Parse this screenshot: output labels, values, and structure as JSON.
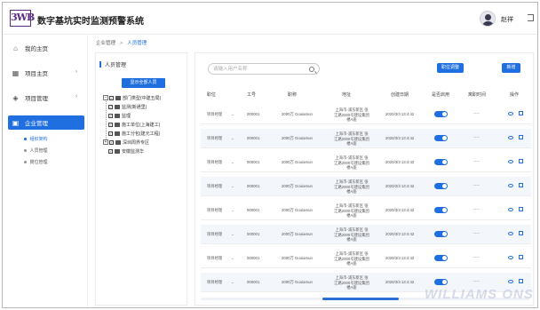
{
  "header": {
    "logo_text": "3WB",
    "title": "数字基坑实时监测预警系统",
    "username": "赵祥"
  },
  "sidebar": {
    "items": [
      {
        "label": "我的主页",
        "icon": "home-icon"
      },
      {
        "label": "项目主页",
        "icon": "grid-icon"
      },
      {
        "label": "项目管理",
        "icon": "cube-icon"
      },
      {
        "label": "企业管理",
        "icon": "building-icon"
      }
    ],
    "sub_items": [
      "组织架构",
      "人员管理",
      "岗位管理"
    ]
  },
  "breadcrumb": {
    "parent": "企业管理",
    "current": "人员管理"
  },
  "left_panel": {
    "title": "人员管理",
    "show_all_button": "显示全部人员",
    "tree": [
      {
        "label": "部门类型(中建五局)",
        "level": 0
      },
      {
        "label": "监测(新通里)",
        "level": 0
      },
      {
        "label": "监理",
        "level": 0
      },
      {
        "label": "施工单位(上海建工)",
        "level": 0
      },
      {
        "label": "施工分包(建元工程)",
        "level": 0
      },
      {
        "label": "深圳周界专区",
        "level": 0
      },
      {
        "label": "安徽监测华",
        "level": 0
      }
    ]
  },
  "right_panel": {
    "search_placeholder": "请输入用户名称",
    "btn_assign": "职位调整",
    "btn_add": "新增",
    "columns": [
      "职位",
      "工号",
      "职称",
      "地址",
      "创建日期",
      "是否启用",
      "离职时间",
      "操作"
    ],
    "rows": [
      {
        "position": "项目经理",
        "id": "000001",
        "title": "2000万 Gooiamun",
        "address": "上海市-浦东新区 张江路2000号建设集团 楼A座",
        "date": "2020/3/3 13:4:42",
        "leave": "----"
      },
      {
        "position": "项目经理",
        "id": "000001",
        "title": "2000万 Gooiamun",
        "address": "上海市-浦东新区 张江路2000号建设集团 楼A座",
        "date": "2020/3/3 13:4:42",
        "leave": "----"
      },
      {
        "position": "项目经理",
        "id": "000001",
        "title": "2000万 Gooiamun",
        "address": "上海市-浦东新区 张江路2000号建设集团 楼A座",
        "date": "2020/3/3 13:4:42",
        "leave": "----"
      },
      {
        "position": "项目经理",
        "id": "000001",
        "title": "2000万 Gooiamun",
        "address": "上海市-浦东新区 张江路2000号建设集团 楼A座",
        "date": "2020/3/3 13:4:42",
        "leave": "----"
      },
      {
        "position": "项目经理",
        "id": "000001",
        "title": "2000万 Gooiamun",
        "address": "上海市-浦东新区 张江路2000号建设集团 楼A座",
        "date": "2020/3/3 13:4:42",
        "leave": "----"
      },
      {
        "position": "项目经理",
        "id": "000001",
        "title": "2000万 Gooiamun",
        "address": "上海市-浦东新区 张江路2000号建设集团 楼A座",
        "date": "2020/3/3 13:4:42",
        "leave": "----"
      },
      {
        "position": "项目经理",
        "id": "000001",
        "title": "2000万 Gooiamun",
        "address": "上海市-浦东新区 张江路2000号建设集团 楼A座",
        "date": "2020/3/3 13:4:42",
        "leave": "----"
      },
      {
        "position": "项目经理",
        "id": "000001",
        "title": "2000万 Gooiamun",
        "address": "上海市-浦东新区 张江路2000号建设集团 楼A座",
        "date": "2020/3/3 13:4:42",
        "leave": "----"
      }
    ]
  },
  "watermark": "WILLIAMS ONS",
  "colors": {
    "accent": "#1f6fe0",
    "logo": "#5b2c83"
  }
}
